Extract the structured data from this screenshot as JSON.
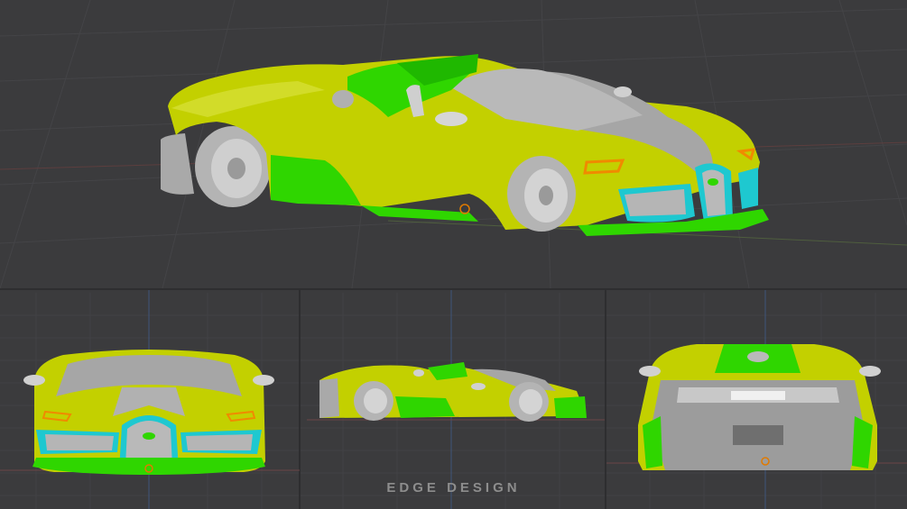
{
  "watermark": "EDGE DESIGN",
  "views": [
    "perspective",
    "front",
    "side",
    "rear"
  ],
  "colors": {
    "background": "#3b3b3d",
    "grid_line": "#464649",
    "body_yellow": "#c8d400",
    "accent_green": "#2fd600",
    "accent_cyan": "#1ec8d0",
    "surface_grey": "#a8a8a8",
    "orange_outline": "#f08a00"
  }
}
